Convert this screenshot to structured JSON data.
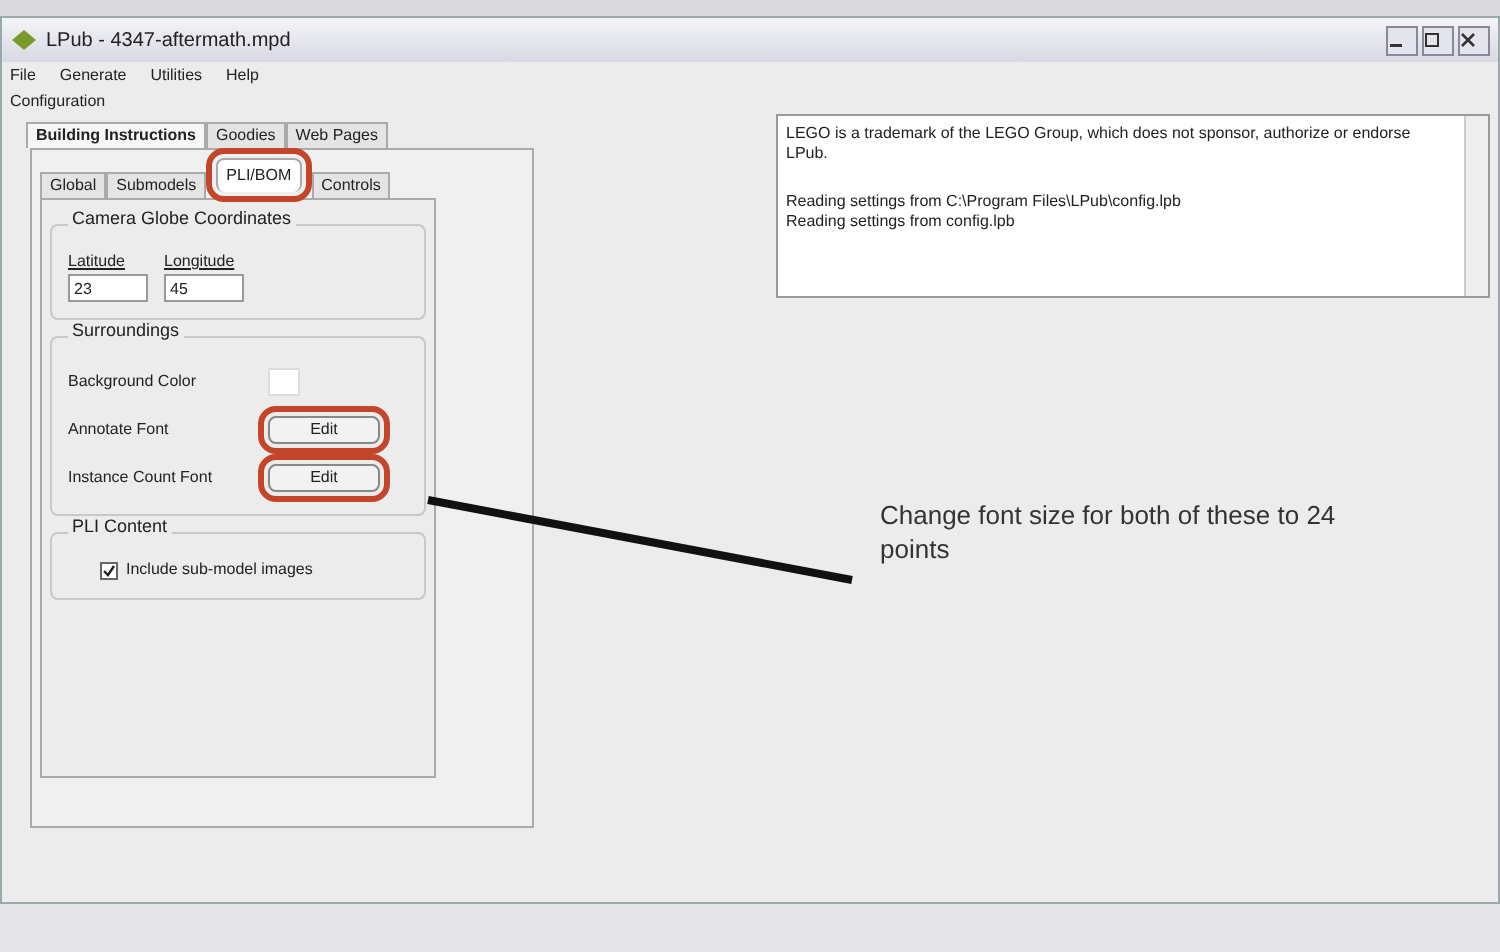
{
  "window": {
    "title": "LPub - 4347-aftermath.mpd"
  },
  "menu": [
    "File",
    "Generate",
    "Utilities",
    "Help"
  ],
  "configuration": {
    "label": "Configuration",
    "tabs": [
      {
        "label": "Building Instructions",
        "selected": true
      },
      {
        "label": "Goodies",
        "selected": false
      },
      {
        "label": "Web Pages",
        "selected": false
      }
    ],
    "subtabs": [
      {
        "label": "Global",
        "selected": false,
        "highlighted": false
      },
      {
        "label": "Submodels",
        "selected": false,
        "highlighted": false
      },
      {
        "label": "PLI/BOM",
        "selected": true,
        "highlighted": true
      },
      {
        "label": "Controls",
        "selected": false,
        "highlighted": false
      }
    ],
    "camera": {
      "title": "Camera Globe Coordinates",
      "fields": [
        {
          "label": "Latitude",
          "value": "23"
        },
        {
          "label": "Longitude",
          "value": "45"
        }
      ]
    },
    "surroundings": {
      "title": "Surroundings",
      "rows": [
        {
          "kind": "color",
          "label": "Background Color",
          "highlighted": false
        },
        {
          "kind": "button",
          "label": "Annotate Font",
          "button": "Edit",
          "highlighted": true
        },
        {
          "kind": "button",
          "label": "Instance Count Font",
          "button": "Edit",
          "highlighted": true
        }
      ]
    },
    "pli_content": {
      "title": "PLI Content",
      "options": [
        {
          "label": "Include sub-model images",
          "checked": true
        }
      ]
    }
  },
  "log": [
    "LEGO is a trademark of the LEGO Group, which does not sponsor, authorize or endorse LPub.",
    "Reading settings from C:\\Program Files\\LPub\\config.lpb",
    "Reading settings from config.lpb"
  ],
  "callout": "Change font size for both of these to 24 points"
}
